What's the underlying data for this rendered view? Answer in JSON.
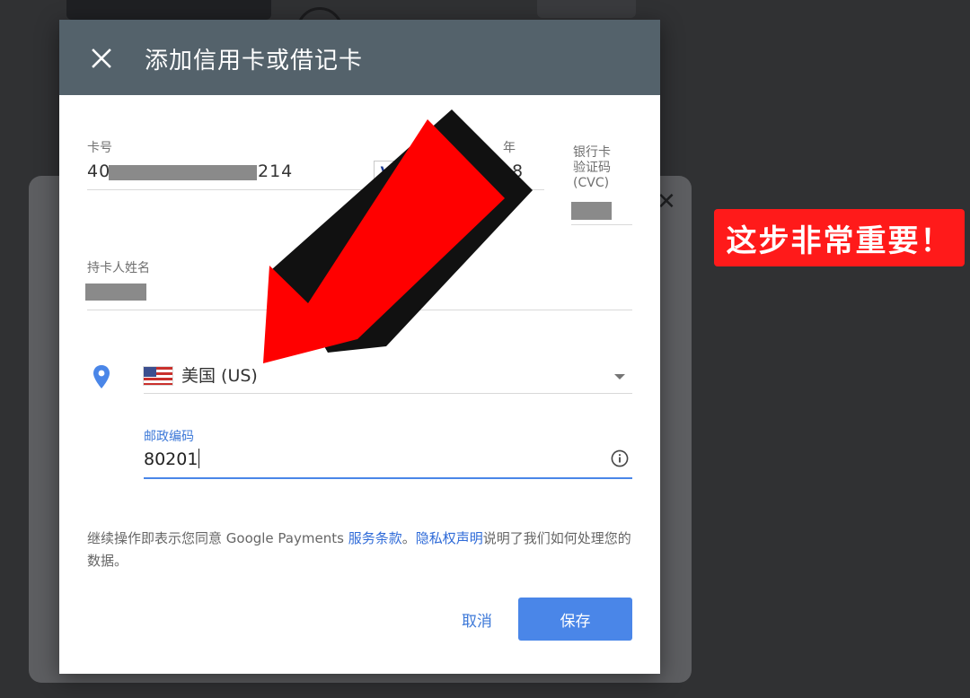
{
  "dialog": {
    "title": "添加信用卡或借记卡",
    "card_number": {
      "label": "卡号",
      "prefix": "40",
      "suffix": "214"
    },
    "year": {
      "label": "年",
      "value_partial": "8"
    },
    "cvc": {
      "label_line1": "银行卡",
      "label_line2": "验证码",
      "label_line3": "(CVC)"
    },
    "cardholder": {
      "label": "持卡人姓名"
    },
    "country": {
      "value": "美国 (US)"
    },
    "postal": {
      "label": "邮政编码",
      "value": "80201"
    },
    "terms": {
      "text_before": "继续操作即表示您同意 Google Payments ",
      "link_terms": "服务条款",
      "separator": "。",
      "link_privacy": "隐私权声明",
      "text_after": "说明了我们如何处理您的数据。"
    },
    "buttons": {
      "cancel": "取消",
      "save": "保存"
    }
  },
  "annotation": {
    "warning_text": "这步非常重要！",
    "arrow_color": "#ff0000"
  },
  "colors": {
    "header_bg": "#54626b",
    "accent": "#4a86e8",
    "link": "#2f6bd8",
    "warning_bg": "#ff1a1a"
  }
}
